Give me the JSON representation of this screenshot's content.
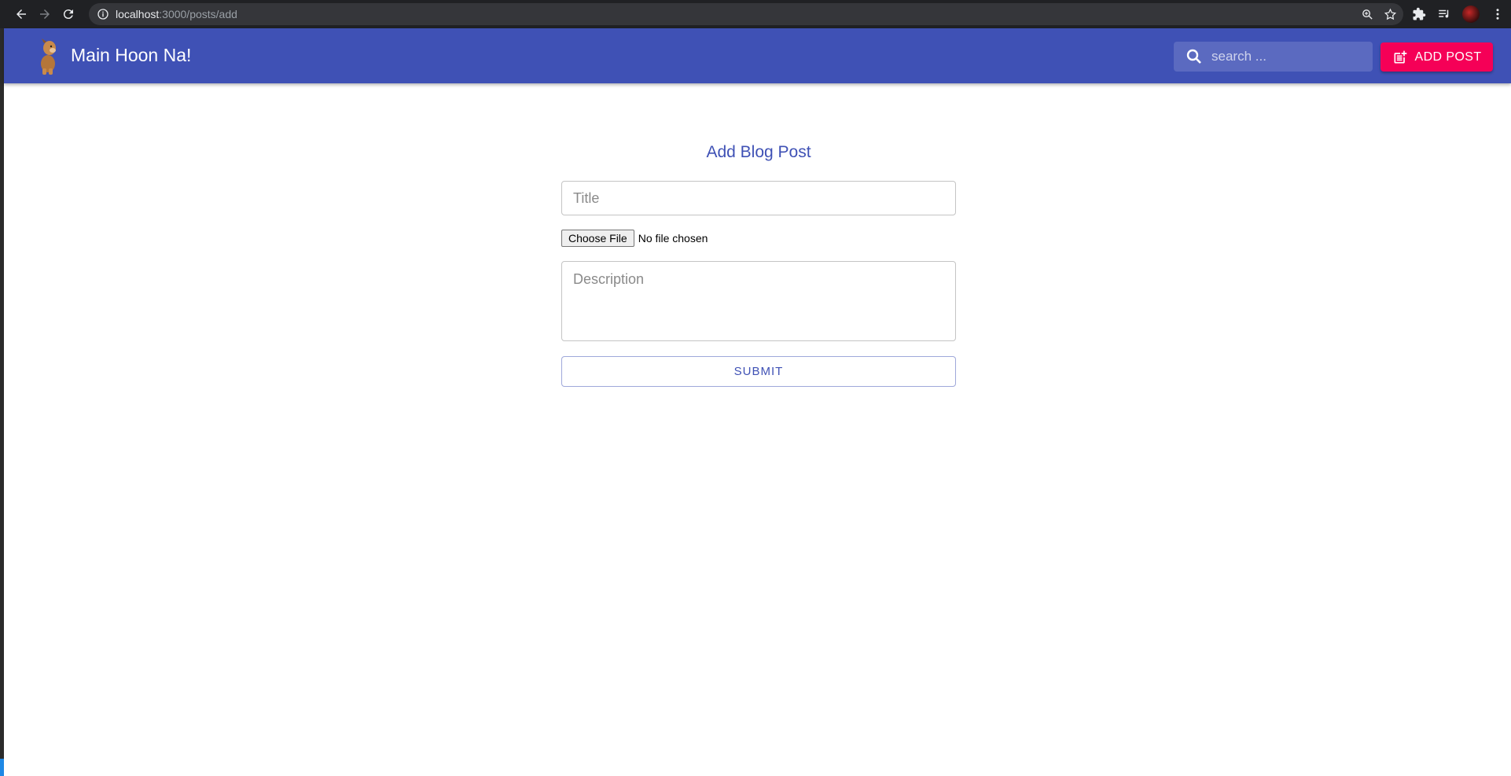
{
  "browser": {
    "url_host": "localhost",
    "url_path": ":3000/posts/add"
  },
  "icons": {
    "back": "back-arrow-icon",
    "forward": "forward-arrow-icon",
    "reload": "reload-icon",
    "info": "info-icon",
    "zoom": "zoom-icon",
    "star": "star-icon",
    "extensions": "puzzle-icon",
    "reading_list": "reading-list-icon",
    "menu": "kebab-menu-icon",
    "search": "search-icon",
    "add_post": "post-add-icon",
    "logo": "dog-logo-icon"
  },
  "colors": {
    "appbar": "#3f51b5",
    "accent": "#f50057",
    "primary_text": "#3f51b5"
  },
  "appbar": {
    "title": "Main Hoon Na!",
    "search_placeholder": "search ...",
    "add_post_label": "ADD POST"
  },
  "form": {
    "heading": "Add Blog Post",
    "title_placeholder": "Title",
    "choose_file_label": "Choose File",
    "file_status": "No file chosen",
    "description_placeholder": "Description",
    "submit_label": "SUBMIT"
  }
}
